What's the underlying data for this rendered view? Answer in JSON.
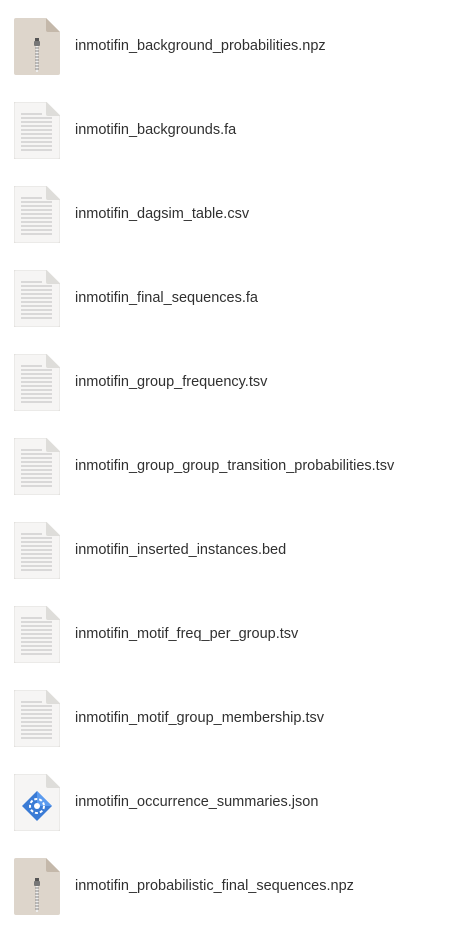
{
  "files": [
    {
      "name": "inmotifin_background_probabilities.npz",
      "icon": "archive-icon"
    },
    {
      "name": "inmotifin_backgrounds.fa",
      "icon": "text-file-icon"
    },
    {
      "name": "inmotifin_dagsim_table.csv",
      "icon": "text-file-icon"
    },
    {
      "name": "inmotifin_final_sequences.fa",
      "icon": "text-file-icon"
    },
    {
      "name": "inmotifin_group_frequency.tsv",
      "icon": "text-file-icon"
    },
    {
      "name": "inmotifin_group_group_transition_probabilities.tsv",
      "icon": "text-file-icon"
    },
    {
      "name": "inmotifin_inserted_instances.bed",
      "icon": "text-file-icon"
    },
    {
      "name": "inmotifin_motif_freq_per_group.tsv",
      "icon": "text-file-icon"
    },
    {
      "name": "inmotifin_motif_group_membership.tsv",
      "icon": "text-file-icon"
    },
    {
      "name": "inmotifin_occurrence_summaries.json",
      "icon": "json-file-icon"
    },
    {
      "name": "inmotifin_probabilistic_final_sequences.npz",
      "icon": "archive-icon"
    }
  ],
  "colors": {
    "archive_body": "#ddd5cb",
    "archive_fold": "#c4b8aa",
    "text_body": "#f6f5f4",
    "text_lines": "#c8c8c8",
    "json_accent": "#3a7bd5"
  }
}
